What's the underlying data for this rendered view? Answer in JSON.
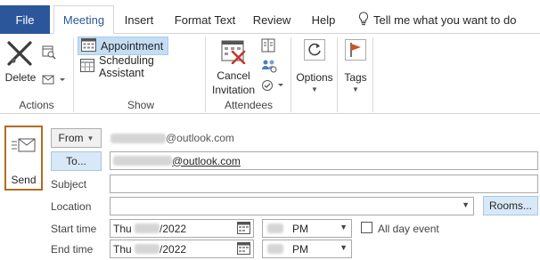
{
  "tabs": {
    "file": "File",
    "meeting": "Meeting",
    "insert": "Insert",
    "format_text": "Format Text",
    "review": "Review",
    "help": "Help",
    "tell_me": "Tell me what you want to do"
  },
  "ribbon": {
    "actions": {
      "delete_label": "Delete",
      "group_label": "Actions"
    },
    "show": {
      "appointment_label": "Appointment",
      "scheduling_label": "Scheduling Assistant",
      "group_label": "Show"
    },
    "attendees": {
      "cancel_label_line1": "Cancel",
      "cancel_label_line2": "Invitation",
      "group_label": "Attendees"
    },
    "options": {
      "label": "Options"
    },
    "tags": {
      "label": "Tags"
    }
  },
  "form": {
    "send_label": "Send",
    "from_label": "From",
    "from_account_suffix": "@outlook.com",
    "to_label": "To...",
    "to_value_suffix": "@outlook.com",
    "subject_label": "Subject",
    "subject_value": "",
    "location_label": "Location",
    "location_value": "",
    "rooms_label": "Rooms...",
    "start_time_label": "Start time",
    "start_date_prefix": "Thu",
    "start_date_suffix": "/2022",
    "start_ampm": "PM",
    "end_time_label": "End time",
    "end_date_prefix": "Thu",
    "end_date_suffix": "/2022",
    "end_ampm": "PM",
    "all_day_label": "All day event"
  },
  "colors": {
    "file_tab": "#2b579a",
    "send_highlight": "#b56b20",
    "selected_button": "#c5ddf2",
    "to_button": "#d9e8f6"
  }
}
